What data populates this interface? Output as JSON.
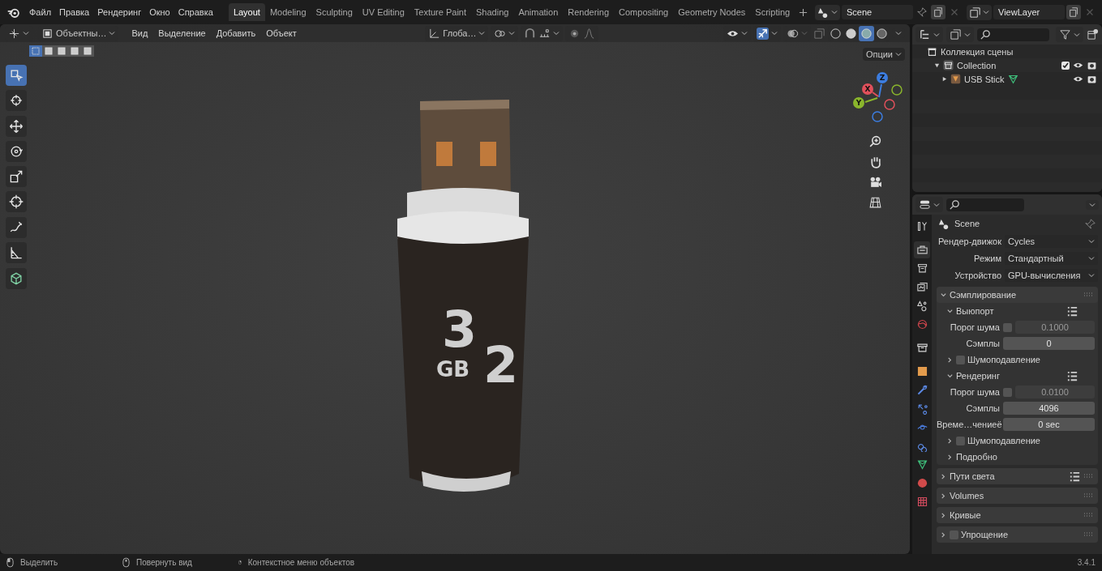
{
  "menu_bar": [
    "Файл",
    "Правка",
    "Рендеринг",
    "Окно",
    "Справка"
  ],
  "workspaces": [
    {
      "label": "Layout",
      "selected": true
    },
    {
      "label": "Modeling",
      "selected": false
    },
    {
      "label": "Sculpting",
      "selected": false
    },
    {
      "label": "UV Editing",
      "selected": false
    },
    {
      "label": "Texture Paint",
      "selected": false
    },
    {
      "label": "Shading",
      "selected": false
    },
    {
      "label": "Animation",
      "selected": false
    },
    {
      "label": "Rendering",
      "selected": false
    },
    {
      "label": "Compositing",
      "selected": false
    },
    {
      "label": "Geometry Nodes",
      "selected": false
    },
    {
      "label": "Scripting",
      "selected": false
    }
  ],
  "scene": {
    "value": "Scene"
  },
  "view_layer": {
    "value": "ViewLayer"
  },
  "viewport": {
    "mode": "Объектны…",
    "menus": [
      "Вид",
      "Выделение",
      "Добавить",
      "Объект"
    ],
    "orientation": "Глоба…",
    "options": "Опции",
    "select_modes": [
      {
        "selected": true
      },
      {
        "selected": false
      },
      {
        "selected": false
      },
      {
        "selected": false
      },
      {
        "selected": false
      }
    ],
    "shading": [
      {
        "selected": false
      },
      {
        "selected": false
      },
      {
        "selected": true
      },
      {
        "selected": false
      }
    ],
    "tool_groups": [
      [
        {
          "kind": "select",
          "selected": true
        },
        {
          "kind": "cursor",
          "selected": false
        }
      ],
      [
        {
          "kind": "move",
          "selected": false
        },
        {
          "kind": "rotate",
          "selected": false
        },
        {
          "kind": "scale",
          "selected": false
        },
        {
          "kind": "transform",
          "selected": false
        }
      ],
      [
        {
          "kind": "annotate",
          "selected": false
        },
        {
          "kind": "measure",
          "selected": false
        }
      ],
      [
        {
          "kind": "add-cube",
          "selected": false
        }
      ]
    ],
    "gizmo_axes": [
      {
        "label": "Z",
        "color": "#3c7de0"
      },
      {
        "label": "X",
        "color": "#e0505b"
      },
      {
        "label": "Y",
        "color": "#8ab52c"
      }
    ],
    "gizmos": {
      "on": true
    },
    "overlays": {
      "on": false
    },
    "model": {
      "digit_1": "3",
      "unit": "GB",
      "digit_2": "2"
    }
  },
  "outliner": {
    "items": [
      {
        "label": "Коллекция сцены",
        "kind": "scene-collection",
        "children": [
          {
            "label": "Collection",
            "kind": "collection",
            "expanded": true,
            "checked": true,
            "children": [
              {
                "label": "USB Stick",
                "kind": "object",
                "expanded": false
              }
            ]
          }
        ]
      }
    ]
  },
  "properties": {
    "tabs": [
      {
        "kind": "tool",
        "selected": false
      },
      {
        "kind": "render",
        "selected": true
      },
      {
        "kind": "output",
        "selected": false
      },
      {
        "kind": "view-layer",
        "selected": false
      },
      {
        "kind": "scene",
        "selected": false
      },
      {
        "kind": "world",
        "selected": false
      },
      {
        "kind": "collection",
        "selected": false
      },
      {
        "kind": "object",
        "selected": false
      },
      {
        "kind": "modifier",
        "selected": false
      },
      {
        "kind": "particles",
        "selected": false
      },
      {
        "kind": "physics",
        "selected": false
      },
      {
        "kind": "constraints",
        "selected": false
      },
      {
        "kind": "data",
        "selected": false
      },
      {
        "kind": "material",
        "selected": false
      },
      {
        "kind": "texture",
        "selected": false
      }
    ],
    "context": "Scene",
    "fields": [
      {
        "label": "Рендер-движок",
        "value": "Cycles"
      },
      {
        "label": "Режим",
        "value": "Стандартный"
      },
      {
        "label": "Устройство",
        "value": "GPU-вычисления"
      }
    ],
    "panels": [
      {
        "title": "Сэмплирование",
        "expanded": true,
        "subpanels": [
          {
            "title": "Выюпорт",
            "expanded": true,
            "presets": true,
            "rows": [
              {
                "kind": "threshold",
                "label": "Порог шума",
                "checked": false,
                "value": "0.1000"
              },
              {
                "kind": "number",
                "label": "Сэмплы",
                "value": "0"
              }
            ]
          },
          {
            "title": "Шумоподавление",
            "expanded": false,
            "checked": false
          },
          {
            "title": "Рендеринг",
            "expanded": true,
            "presets": true,
            "rows": [
              {
                "kind": "threshold",
                "label": "Порог шума",
                "checked": false,
                "value": "0.0100"
              },
              {
                "kind": "number",
                "label": "Сэмплы",
                "value": "4096"
              },
              {
                "kind": "number",
                "label": "Време…чениеё",
                "value": "0 sec"
              }
            ]
          },
          {
            "title": "Шумоподавление",
            "expanded": false,
            "checked": false
          },
          {
            "title": "Подробно",
            "expanded": false
          }
        ]
      },
      {
        "title": "Пути света",
        "expanded": false,
        "presets": true
      },
      {
        "title": "Volumes",
        "expanded": false
      },
      {
        "title": "Кривые",
        "expanded": false
      },
      {
        "title": "Упрощение",
        "expanded": false,
        "checked": false
      }
    ]
  },
  "status_bar": {
    "hints": [
      {
        "label": "Выделить",
        "kind": "left"
      },
      {
        "label": "Повернуть вид",
        "kind": "middle"
      },
      {
        "label": "Контекстное меню объектов",
        "kind": "right"
      }
    ],
    "version": "3.4.1"
  }
}
